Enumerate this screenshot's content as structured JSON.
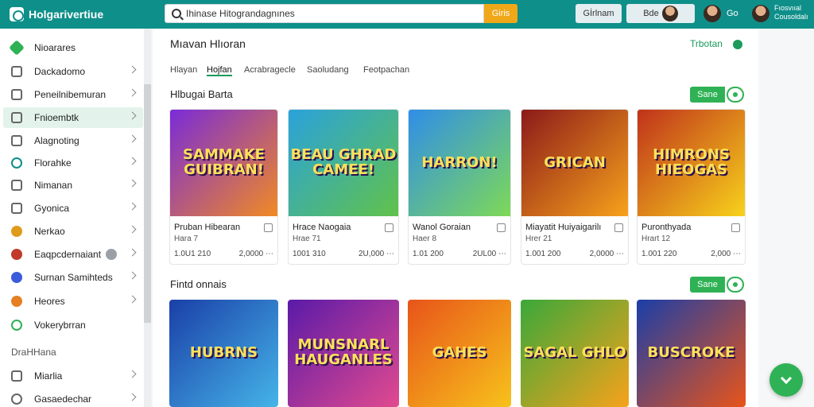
{
  "app": {
    "title": "Holgarivertiue"
  },
  "search": {
    "value": "Ihinase Hitograndagnınes",
    "button_label": "Giris"
  },
  "topbar": {
    "chip1": "Gİrlnam",
    "chip2": "Bde",
    "user_short": "Go",
    "user_name_line1": "Fıosvııal",
    "user_name_line2": "Cousoldalı"
  },
  "sidebar": {
    "items": [
      {
        "label": "Nioarares",
        "color": "#2fb255"
      },
      {
        "label": "Dackadomo",
        "color": "#666666"
      },
      {
        "label": "Peneilnibemuran",
        "color": "#666666"
      },
      {
        "label": "Fnioembtk",
        "color": "#666666"
      },
      {
        "label": "Alagnoting",
        "color": "#666666"
      },
      {
        "label": "Florahke",
        "color": "#0f8f8a"
      },
      {
        "label": "Nimanan",
        "color": "#666666"
      },
      {
        "label": "Gyonica",
        "color": "#666666"
      },
      {
        "label": "Nerkao",
        "color": "#e09b1a"
      },
      {
        "label": "Eaqpcdernaiant",
        "color": "#c0392b"
      },
      {
        "label": "Surnan Samihteds",
        "color": "#3b5bdb"
      },
      {
        "label": "Heores",
        "color": "#e67e22"
      },
      {
        "label": "Vokerybrran",
        "color": "#2fb255"
      },
      {
        "label": "Miarlia",
        "color": "#666666"
      },
      {
        "label": "Gasaedechar",
        "color": "#666666"
      }
    ],
    "section_label": "DraHHana"
  },
  "main": {
    "title": "Mıavan Hlıoran",
    "title_right": "Trbotan",
    "tabs": [
      "Hlayan",
      "Hojfan",
      "Acrabragecle",
      "Saoludang",
      "Feotpachan"
    ],
    "section1": {
      "title": "Hlbugai Barta",
      "see_all": "Sane"
    },
    "section2": {
      "title": "Fintd onnais",
      "see_all": "Sane"
    },
    "cards": [
      {
        "name": "Pruban Hibearan",
        "sub": "Hara 7",
        "stat_l": "1.0U1 210",
        "stat_r": "2,0000 ⋯",
        "art": "SAMMAKE GUIBRAN!",
        "bg": "linear-gradient(135deg,#7a2bd8,#f08a24)"
      },
      {
        "name": "Hrace Naogaia",
        "sub": "Hrae 71",
        "stat_l": "1001 310",
        "stat_r": "2U,000 ⋯",
        "art": "BEAU GHRAD CAMEE!",
        "bg": "linear-gradient(135deg,#2aa2dc,#61c24a)"
      },
      {
        "name": "Wanol Goraian",
        "sub": "Haer 8",
        "stat_l": "1.01 200",
        "stat_r": "2UL00 ⋯",
        "art": "HARRON!",
        "bg": "linear-gradient(135deg,#2f8ee8,#7ed957)"
      },
      {
        "name": "Miayatit Huiyaigarilı",
        "sub": "Hrer 21",
        "stat_l": "1.001 200",
        "stat_r": "2,0000 ⋯",
        "art": "GRICAN",
        "bg": "linear-gradient(135deg,#8b1a1a,#f7a21b)"
      },
      {
        "name": "Puronthyada",
        "sub": "Hrart 12",
        "stat_l": "1.001 220",
        "stat_r": "2,000 ⋯",
        "art": "HIMRONS HIEOGAS",
        "bg": "linear-gradient(135deg,#c0321b,#f7d21b)"
      }
    ],
    "cards2": [
      {
        "art": "HUBRNS",
        "bg": "linear-gradient(135deg,#1a3fa8,#45b4e8)"
      },
      {
        "art": "MUNSNARL HAUGANLES",
        "bg": "linear-gradient(135deg,#5a1aa8,#e24a8f)"
      },
      {
        "art": "GAHES",
        "bg": "linear-gradient(135deg,#e8541a,#f7c21b)"
      },
      {
        "art": "SAGAL GHLO",
        "bg": "linear-gradient(135deg,#3aa83a,#f7a21b)"
      },
      {
        "art": "BUSCROKE",
        "bg": "linear-gradient(135deg,#1a3ea8,#e8541a)"
      }
    ]
  }
}
